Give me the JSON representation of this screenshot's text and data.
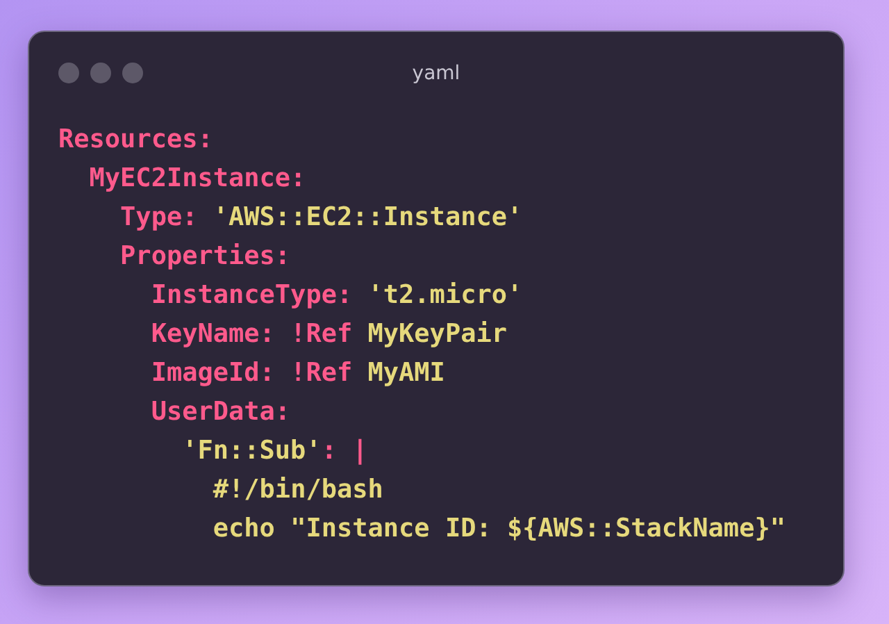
{
  "window": {
    "title": "yaml"
  },
  "code": [
    {
      "tokens": [
        {
          "text": "Resources:",
          "kind": "key"
        }
      ],
      "children": [
        {
          "tokens": [
            {
              "text": "MyEC2Instance:",
              "kind": "key"
            }
          ],
          "children": [
            {
              "tokens": [
                {
                  "text": "Type: ",
                  "kind": "key"
                },
                {
                  "text": "'AWS::EC2::Instance'",
                  "kind": "string"
                }
              ]
            },
            {
              "tokens": [
                {
                  "text": "Properties:",
                  "kind": "key"
                }
              ],
              "children": [
                {
                  "tokens": [
                    {
                      "text": "InstanceType: ",
                      "kind": "key"
                    },
                    {
                      "text": "'t2.micro'",
                      "kind": "string"
                    }
                  ]
                },
                {
                  "tokens": [
                    {
                      "text": "KeyName: !Ref ",
                      "kind": "key"
                    },
                    {
                      "text": "MyKeyPair",
                      "kind": "string"
                    }
                  ]
                },
                {
                  "tokens": [
                    {
                      "text": "ImageId: !Ref ",
                      "kind": "key"
                    },
                    {
                      "text": "MyAMI",
                      "kind": "string"
                    }
                  ]
                },
                {
                  "tokens": [
                    {
                      "text": "UserData:",
                      "kind": "key"
                    }
                  ],
                  "children": [
                    {
                      "tokens": [
                        {
                          "text": "'Fn::Sub'",
                          "kind": "string"
                        },
                        {
                          "text": ": |",
                          "kind": "key"
                        }
                      ],
                      "children": [
                        {
                          "tokens": [
                            {
                              "text": "#!/bin/bash",
                              "kind": "string"
                            }
                          ]
                        },
                        {
                          "tokens": [
                            {
                              "text": "echo \"Instance ID: ${AWS::StackName}\"",
                              "kind": "string"
                            }
                          ]
                        }
                      ]
                    }
                  ]
                }
              ]
            }
          ]
        }
      ]
    }
  ]
}
